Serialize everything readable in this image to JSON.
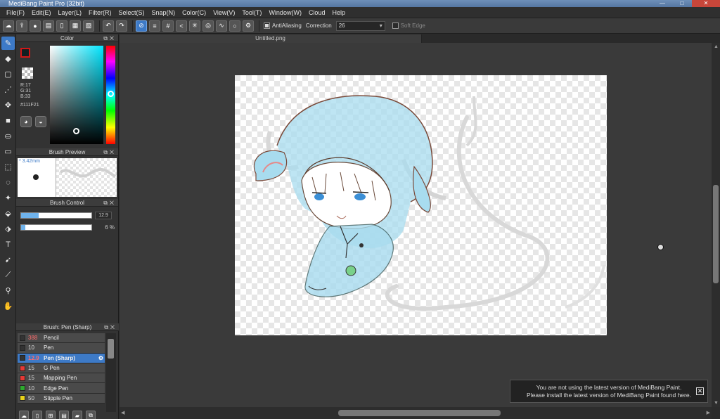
{
  "window": {
    "title": "MediBang Paint Pro (32bit)",
    "minimize": "—",
    "maximize": "□",
    "close": "✕"
  },
  "menu": [
    "File(F)",
    "Edit(E)",
    "Layer(L)",
    "Filter(R)",
    "Select(S)",
    "Snap(N)",
    "Color(C)",
    "View(V)",
    "Tool(T)",
    "Window(W)",
    "Cloud",
    "Help"
  ],
  "toolbar": {
    "antialiasing_label": "AntiAliasing",
    "correction_label": "Correction",
    "correction_value": "26",
    "soft_edge_label": "Soft Edge"
  },
  "color_panel": {
    "title": "Color",
    "r": "R:17",
    "g": "G:31",
    "b": "B:33",
    "hex": "#111F21",
    "foreground": "#111f21"
  },
  "brush_preview": {
    "title": "Brush Preview",
    "size": "* 3.42mm"
  },
  "brush_control": {
    "title": "Brush Control",
    "size_value": "12.9",
    "size_fraction": 0.25,
    "opacity_value": "6 %",
    "opacity_fraction": 0.06
  },
  "brush_list": {
    "title": "Brush: Pen (Sharp)",
    "items": [
      {
        "size": "388",
        "name": "Pencil",
        "color": "#333333",
        "size_red": true
      },
      {
        "size": "10",
        "name": "Pen",
        "color": "#333333",
        "size_red": false
      },
      {
        "size": "12.9",
        "name": "Pen (Sharp)",
        "color": "#333333",
        "size_red": true,
        "selected": true
      },
      {
        "size": "15",
        "name": "G Pen",
        "color": "#e53935",
        "size_red": false
      },
      {
        "size": "15",
        "name": "Mapping Pen",
        "color": "#e53935",
        "size_red": false
      },
      {
        "size": "10",
        "name": "Edge Pen",
        "color": "#2eaa2e",
        "size_red": false
      },
      {
        "size": "50",
        "name": "Stipple Pen",
        "color": "#e8d21a",
        "size_red": false
      }
    ]
  },
  "document": {
    "tab": "Untitled.png"
  },
  "notice": {
    "line1": "You are not using the latest version of MediBang Paint.",
    "line2": "Please install the latest version of MediBang Paint found here.",
    "close": "✕"
  }
}
